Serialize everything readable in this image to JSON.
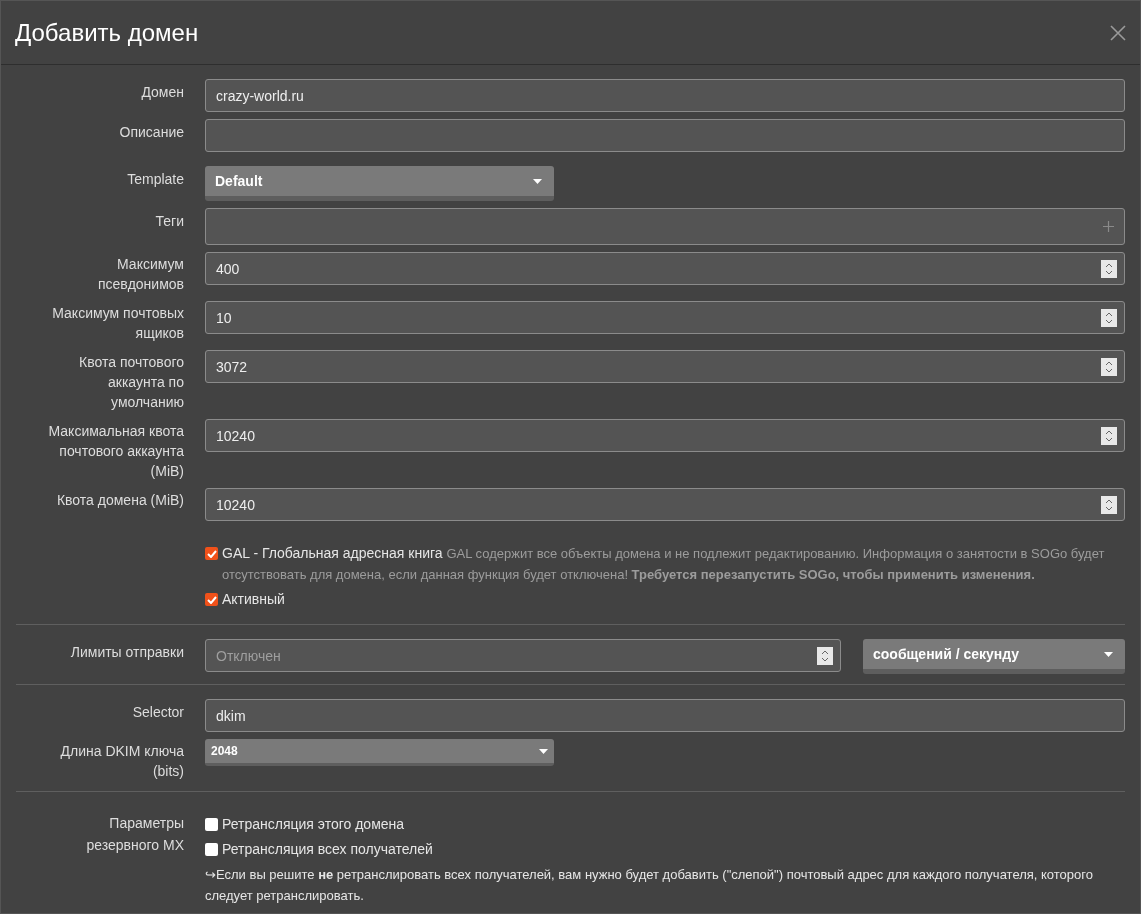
{
  "title": "Добавить домен",
  "rows": [
    {
      "kind": "text",
      "label": "Домен",
      "value": "crazy-world.ru"
    },
    {
      "kind": "text",
      "label": "Описание"
    },
    {
      "kind": "select",
      "label": "Template",
      "value": "Default"
    },
    {
      "kind": "tags",
      "label": "Теги"
    },
    {
      "kind": "number",
      "label": "Максимум псевдонимов",
      "value": "400"
    },
    {
      "kind": "number",
      "label": "Максимум почтовых ящиков",
      "value": "10"
    },
    {
      "kind": "number",
      "label": "Квота почтового аккаунта по умолчанию",
      "value": "3072"
    },
    {
      "kind": "number",
      "label": "Максимальная квота почтового аккаунта (MiB)",
      "value": "10240"
    },
    {
      "kind": "number",
      "label": "Квота домена (MiB)",
      "value": "10240"
    },
    {
      "kind": "checks",
      "items": [
        {
          "label": "GAL - Глобальная адресная книга",
          "help": "GAL содержит все объекты домена и не подлежит редактированию. Информация о занятости в SOGo будет отсутствовать для домена, если данная функция будет отключена! **Требуется перезапустить SOGo, чтобы применить изменения.**",
          "checked": true
        },
        {
          "label": "Активный",
          "checked": true
        }
      ]
    },
    {
      "kind": "divider"
    },
    {
      "kind": "rate",
      "label": "Лимиты отправки",
      "placeholder": "Отключен",
      "unit": "сообщений / секунду"
    },
    {
      "kind": "divider"
    },
    {
      "kind": "text",
      "label": "Selector",
      "value": "dkim"
    },
    {
      "kind": "compact-select",
      "label": "Длина DKIM ключа (bits)",
      "value": "2048"
    },
    {
      "kind": "divider"
    },
    {
      "kind": "checks",
      "label": "Параметры резервного MX",
      "items": [
        {
          "label": "Ретрансляция этого домена",
          "checked": false
        },
        {
          "label": "Ретрансляция всех получателей",
          "checked": false
        }
      ],
      "note": "↪Если вы решите **не** ретранслировать всех получателей, вам нужно будет добавить (\"слепой\") почтовый адрес для каждого получателя, которого следует ретранслировать."
    }
  ]
}
